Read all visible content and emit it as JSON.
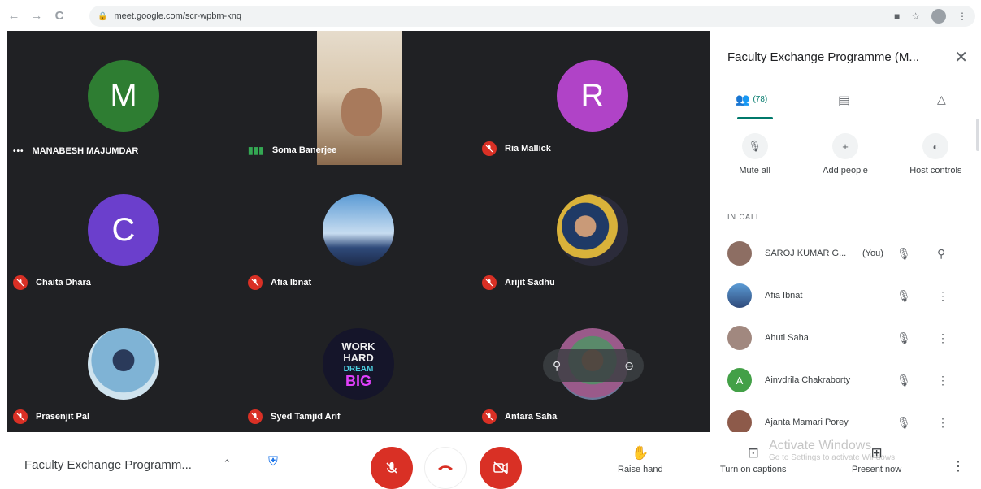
{
  "browser": {
    "url": "meet.google.com/scr-wpbm-knq",
    "back": "←",
    "forward": "→",
    "reload": "C"
  },
  "tiles": [
    {
      "name": "MANABESH MAJUMDAR",
      "initial": "M",
      "color": "#2e7d32",
      "mic": "dots"
    },
    {
      "name": "Soma Banerjee",
      "initial": "",
      "color": "",
      "mic": "speaking"
    },
    {
      "name": "Ria Mallick",
      "initial": "R",
      "color": "#b043c7",
      "mic": "off"
    },
    {
      "name": "Chaita Dhara",
      "initial": "C",
      "color": "#6b3fcc",
      "mic": "off"
    },
    {
      "name": "Afia Ibnat",
      "initial": "",
      "color": "#4a7fc1",
      "mic": "off"
    },
    {
      "name": "Arijit Sadhu",
      "initial": "",
      "color": "#3a4a7a",
      "mic": "off"
    },
    {
      "name": "Prasenjit Pal",
      "initial": "",
      "color": "#6aa7c8",
      "mic": "off"
    },
    {
      "name": "Syed Tamjid Arif",
      "initial": "",
      "color": "#1a1a2e",
      "mic": "off",
      "badge": [
        "WORK",
        "HARD",
        "DREAM",
        "BIG"
      ]
    },
    {
      "name": "Antara Saha",
      "initial": "",
      "color": "#7a6a5a",
      "mic": "off"
    }
  ],
  "panel": {
    "title": "Faculty Exchange Programme (M...",
    "close": "✕",
    "people_count": "(78)",
    "actions": [
      {
        "label": "Mute all",
        "icon": "mic-off-icon"
      },
      {
        "label": "Add people",
        "icon": "person-add-icon"
      },
      {
        "label": "Host controls",
        "icon": "toggle-icon"
      }
    ],
    "section_label": "IN CALL",
    "people": [
      {
        "name": "SAROJ KUMAR G...",
        "you": "(You)",
        "initial": "",
        "color": "#8d6e63",
        "right_icon": "pin-icon"
      },
      {
        "name": "Afia Ibnat",
        "you": "",
        "initial": "",
        "color": "#3f6fb5",
        "right_icon": "more-icon"
      },
      {
        "name": "Ahuti Saha",
        "you": "",
        "initial": "",
        "color": "#a1887f",
        "right_icon": "more-icon"
      },
      {
        "name": "Ainvdrila Chakraborty",
        "you": "",
        "initial": "A",
        "color": "#43a047",
        "right_icon": "more-icon"
      },
      {
        "name": "Ajanta Mamari Porey",
        "you": "",
        "initial": "",
        "color": "#8d5a4a",
        "right_icon": "more-icon"
      }
    ]
  },
  "bottom": {
    "meeting_name": "Faculty Exchange Programm...",
    "raise_hand": "Raise hand",
    "captions": "Turn on captions",
    "present": "Present now",
    "watermark_title": "Activate Windows",
    "watermark_sub": "Go to Settings to activate Windows."
  }
}
